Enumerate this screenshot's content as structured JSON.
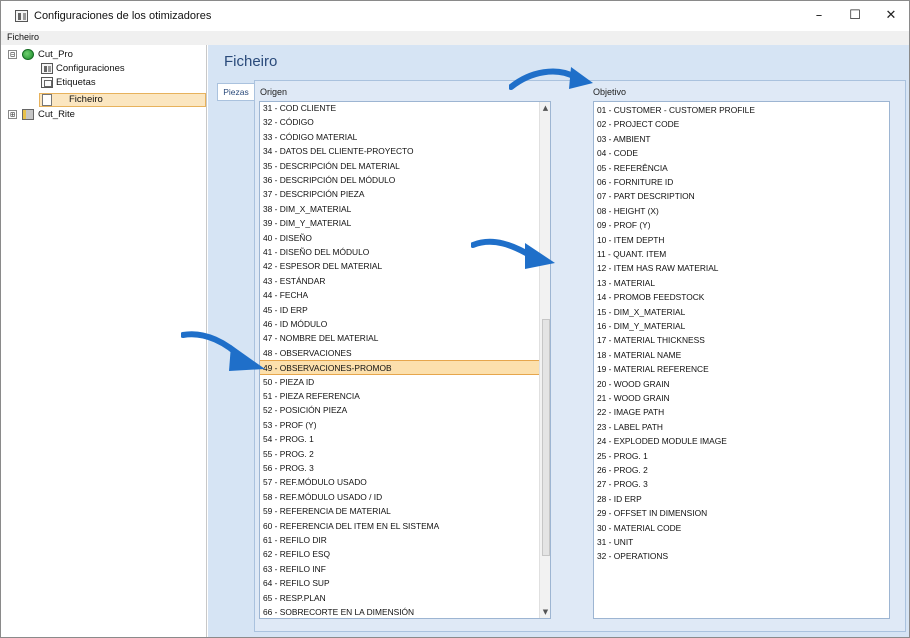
{
  "window": {
    "title": "Configuraciones de los otimizadores",
    "controls": {
      "minimize": "–",
      "maximize": "☐",
      "close": "✕"
    }
  },
  "menu": {
    "items": [
      "Ficheiro"
    ]
  },
  "tree": {
    "nodes": [
      {
        "label": "Cut_Pro",
        "expander": "⊟",
        "icon": "globe-icon"
      },
      {
        "label": "Configuraciones",
        "icon": "config-icon"
      },
      {
        "label": "Etiquetas",
        "icon": "label-icon"
      },
      {
        "label": "Ficheiro",
        "icon": "file-icon",
        "selected": true
      },
      {
        "label": "Cut_Rite",
        "expander": "⊞",
        "icon": "cutrite-icon"
      }
    ]
  },
  "main": {
    "heading": "Ficheiro",
    "tab": "Piezas",
    "origin_label": "Origen",
    "target_label": "Objetivo",
    "origin_items": [
      "31 - COD CLIENTE",
      "32 - CÓDIGO",
      "33 - CÓDIGO MATERIAL",
      "34 - DATOS DEL CLIENTE-PROYECTO",
      "35 - DESCRIPCIÓN DEL MATERIAL",
      "36 - DESCRIPCIÓN DEL MÓDULO",
      "37 - DESCRIPCIÓN PIEZA",
      "38 - DIM_X_MATERIAL",
      "39 - DIM_Y_MATERIAL",
      "40 - DISEÑO",
      "41 - DISEÑO DEL MÓDULO",
      "42 - ESPESOR DEL MATERIAL",
      "43 - ESTÁNDAR",
      "44 - FECHA",
      "45 - ID ERP",
      "46 - ID MÓDULO",
      "47 - NOMBRE DEL MATERIAL",
      "48 - OBSERVACIONES",
      "49 - OBSERVACIONES-PROMOB",
      "50 - PIEZA ID",
      "51 - PIEZA REFERENCIA",
      "52 - POSICIÓN PIEZA",
      "53 - PROF (Y)",
      "54 - PROG. 1",
      "55 - PROG. 2",
      "56 - PROG. 3",
      "57 - REF.MÓDULO USADO",
      "58 - REF.MÓDULO USADO / ID",
      "59 - REFERENCIA DE MATERIAL",
      "60 - REFERENCIA DEL ITEM EN EL SISTEMA",
      "61 - REFILO DIR",
      "62 - REFILO ESQ",
      "63 - REFILO INF",
      "64 - REFILO SUP",
      "65 - RESP.PLAN",
      "66 - SOBRECORTE EN LA DIMENSIÓN"
    ],
    "selected_origin": "49 - OBSERVACIONES-PROMOB",
    "target_items": [
      "01 - CUSTOMER - CUSTOMER PROFILE",
      "02 - PROJECT CODE",
      "03 - AMBIENT",
      "04 - CODE",
      "05 - REFERÊNCIA",
      "06 - FORNITURE ID",
      "07 - PART DESCRIPTION",
      "08 - HEIGHT (X)",
      "09 - PROF (Y)",
      "10 - ITEM DEPTH",
      "11 - QUANT. ITEM",
      "12 - ITEM HAS RAW MATERIAL",
      "13 - MATERIAL",
      "14 - PROMOB FEEDSTOCK",
      "15 - DIM_X_MATERIAL",
      "16 - DIM_Y_MATERIAL",
      "17 - MATERIAL THICKNESS",
      "18 - MATERIAL NAME",
      "19 - MATERIAL REFERENCE",
      "20 - WOOD GRAIN",
      "21 - WOOD GRAIN",
      "22 - IMAGE PATH",
      "23 - LABEL PATH",
      "24 - EXPLODED MODULE IMAGE",
      "25 - PROG. 1",
      "26 - PROG. 2",
      "27 - PROG. 3",
      "28 - ID ERP",
      "29 - OFFSET IN DIMENSION",
      "30 - MATERIAL CODE",
      "31 - UNIT",
      "32 - OPERATIONS"
    ],
    "buttons": [
      {
        "name": "add-all-button",
        "glyph": "⇛",
        "active": true
      },
      {
        "name": "add-button",
        "glyph": "➡",
        "active": true
      },
      {
        "name": "move-up-button",
        "glyph": "▲",
        "active": false
      },
      {
        "name": "move-down-button",
        "glyph": "▼",
        "active": false
      },
      {
        "name": "remove-button",
        "glyph": "✖",
        "active": false
      },
      {
        "name": "separator-button",
        "glyph": "⚲",
        "active": false
      },
      {
        "name": "settings-button",
        "glyph": "⚙",
        "active": false
      },
      {
        "name": "refresh-button",
        "glyph": "⟳",
        "active": false
      }
    ]
  },
  "colors": {
    "accent": "#2a4a7a",
    "selection": "#fce0ad",
    "arrow": "#1f6fc9"
  }
}
